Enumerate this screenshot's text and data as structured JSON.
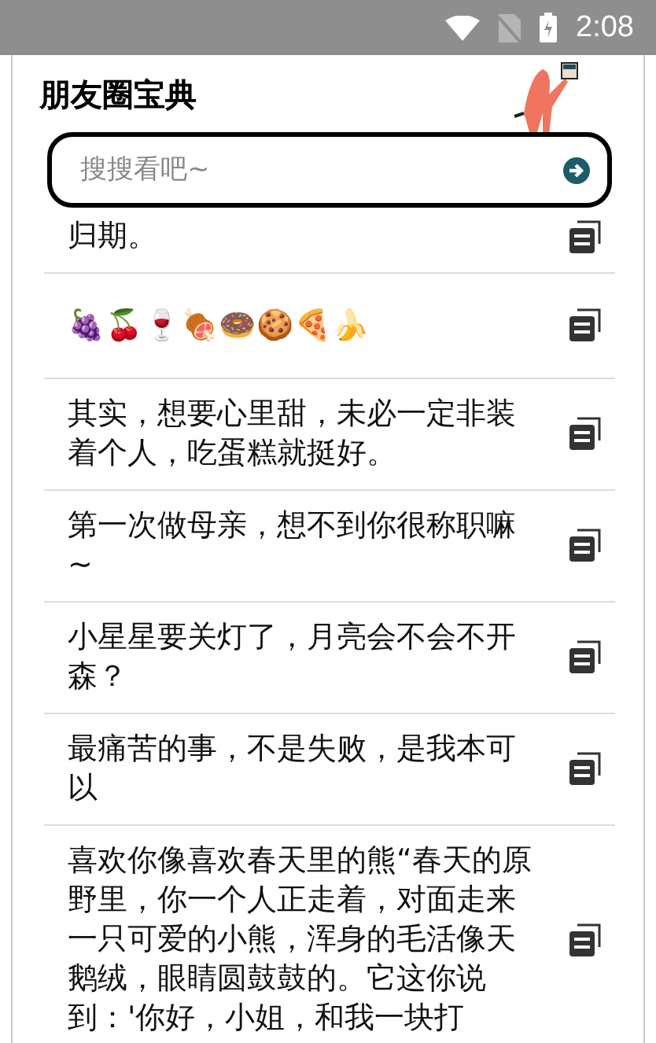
{
  "status_bar": {
    "time": "2:08"
  },
  "app": {
    "title": "朋友圈宝典",
    "search": {
      "placeholder": "搜搜看吧~"
    }
  },
  "quotes": [
    {
      "text": "归期。"
    },
    {
      "text": "🍇🍒🍷🍖🍩🍪🍕🍌"
    },
    {
      "text": "其实，想要心里甜，未必一定非装着个人，吃蛋糕就挺好。"
    },
    {
      "text": "第一次做母亲，想不到你很称职嘛~"
    },
    {
      "text": "小星星要关灯了，月亮会不会不开森？"
    },
    {
      "text": "最痛苦的事，不是失败，是我本可以"
    },
    {
      "text": "喜欢你像喜欢春天里的熊“春天的原野里，你一个人正走着，对面走来一只可爱的小熊，浑身的毛活像天鹅绒，眼睛圆鼓鼓的。它这你说到：'你好，小姐，和我一块打"
    }
  ]
}
